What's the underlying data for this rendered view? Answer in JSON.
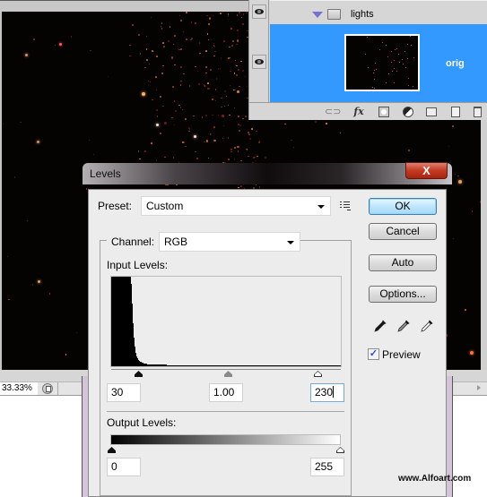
{
  "document": {
    "zoom_level": "33.33%"
  },
  "layers_panel": {
    "group": {
      "name": "lights",
      "expanded": true,
      "visible": true
    },
    "layer": {
      "name": "orig",
      "visible": true,
      "selected": true
    },
    "footer_icons": [
      "link-icon",
      "fx-icon",
      "layer-mask-icon",
      "adjustment-layer-icon",
      "new-group-icon",
      "new-layer-icon",
      "trash-icon"
    ],
    "fx_label": "fx"
  },
  "dialog": {
    "title": "Levels",
    "close_label": "X",
    "preset": {
      "label": "Preset:",
      "value": "Custom"
    },
    "channel": {
      "label": "Channel:",
      "value": "RGB"
    },
    "input_levels": {
      "label": "Input Levels:",
      "black": "30",
      "midtone": "1.00",
      "white": "230"
    },
    "output_levels": {
      "label": "Output Levels:",
      "black": "0",
      "white": "255"
    },
    "buttons": {
      "ok": "OK",
      "cancel": "Cancel",
      "auto": "Auto",
      "options": "Options..."
    },
    "eyedroppers": [
      "black-point-eyedropper-icon",
      "gray-point-eyedropper-icon",
      "white-point-eyedropper-icon"
    ],
    "preview": {
      "label": "Preview",
      "checked": true,
      "check_glyph": "✓"
    },
    "accent_color": "#3399ff"
  },
  "histogram_data": {
    "type": "area",
    "x_range": [
      0,
      255
    ],
    "relative_counts": [
      1.0,
      1.0,
      1.0,
      1.0,
      1.0,
      1.0,
      1.0,
      1.0,
      1.0,
      1.0,
      1.0,
      1.0,
      1.0,
      1.0,
      1.0,
      1.0,
      1.0,
      1.0,
      1.0,
      1.0,
      1.0,
      1.0,
      0.92,
      0.7,
      0.48,
      0.32,
      0.22,
      0.15,
      0.11,
      0.09,
      0.07,
      0.06,
      0.05,
      0.045,
      0.04,
      0.035,
      0.03,
      0.03,
      0.025,
      0.025,
      0.02,
      0.02,
      0.02,
      0.02,
      0.02,
      0.02,
      0.02,
      0.02,
      0.02,
      0.02,
      0.02,
      0.02,
      0.02,
      0.02,
      0.02,
      0.02,
      0.02,
      0.015,
      0.015,
      0.015,
      0.015,
      0.015
    ]
  },
  "watermark": "www.Alfoart.com"
}
